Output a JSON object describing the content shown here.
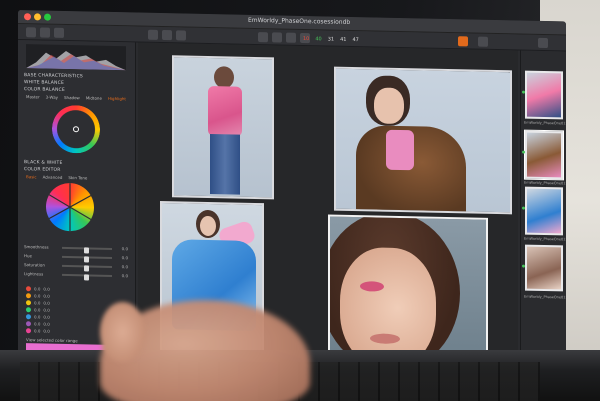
{
  "window": {
    "title": "EmWorldy_PhaseOne.cosessiondb"
  },
  "toolbar": {
    "counts": [
      "10",
      "40",
      "31",
      "41",
      "47"
    ]
  },
  "left_panel": {
    "sections": {
      "base_characteristics": "BASE CHARACTERISTICS",
      "white_balance": "WHITE BALANCE",
      "color_balance": "COLOR BALANCE",
      "black_white": "BLACK & WHITE",
      "color_editor": "COLOR EDITOR"
    },
    "mode_tabs": [
      "Master",
      "3-Way",
      "Shadow",
      "Midtone",
      "Highlight"
    ],
    "editor_tabs": [
      "Basic",
      "Advanced",
      "Skin Tone"
    ],
    "sliders": [
      {
        "label": "Smoothness",
        "value": "0.0",
        "position": 0.5
      },
      {
        "label": "Hue",
        "value": "0.0",
        "position": 0.5
      },
      {
        "label": "Saturation",
        "value": "0.0",
        "position": 0.5
      },
      {
        "label": "Lightness",
        "value": "0.0",
        "position": 0.5
      }
    ],
    "color_rows": [
      {
        "color": "#e84b3c",
        "a": "0.0",
        "b": "0.0"
      },
      {
        "color": "#f39c12",
        "a": "0.0",
        "b": "0.0"
      },
      {
        "color": "#f1c40f",
        "a": "0.0",
        "b": "0.0"
      },
      {
        "color": "#2ecc71",
        "a": "0.0",
        "b": "0.0"
      },
      {
        "color": "#3498db",
        "a": "0.0",
        "b": "0.0"
      },
      {
        "color": "#9b59b6",
        "a": "0.0",
        "b": "0.0"
      },
      {
        "color": "#e84393",
        "a": "0.0",
        "b": "0.0"
      }
    ],
    "selected_range_label": "View selected color range",
    "range_color": "#e86ed0"
  },
  "browser": {
    "thumbs": [
      {
        "caption": "EmWorldy_PhaseOne0134.IIQ"
      },
      {
        "caption": "EmWorldy_PhaseOne0135.IIQ"
      },
      {
        "caption": "EmWorldy_PhaseOne0136.IIQ"
      },
      {
        "caption": "EmWorldy_PhaseOne0138.IIQ"
      }
    ]
  },
  "colors": {
    "accent": "#e26a1c",
    "panel": "#2d2e32",
    "viewer": "#262729",
    "selection_green": "#46c25a"
  },
  "icons": [
    "cursor-icon",
    "crop-icon",
    "rotate-icon",
    "loupe-icon",
    "brush-icon",
    "eraser-icon",
    "picker-icon",
    "zoom-icon",
    "settings-icon"
  ]
}
